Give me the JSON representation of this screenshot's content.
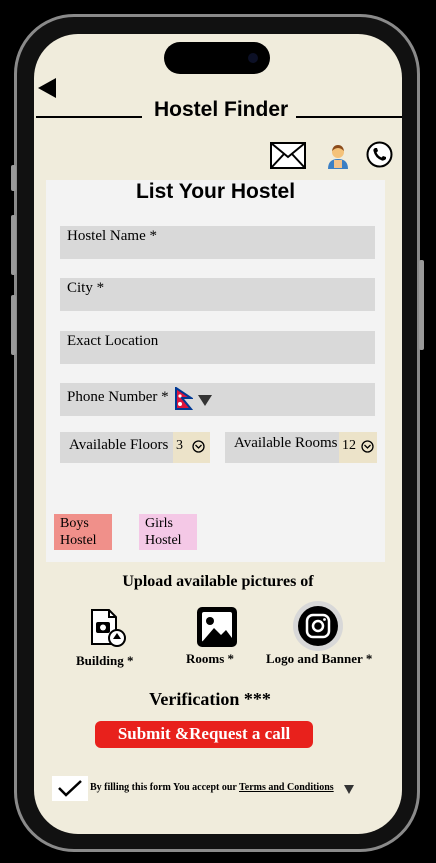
{
  "header": {
    "title": "Hostel Finder"
  },
  "icons": {
    "back": "back-arrow-icon",
    "mail": "mail-icon",
    "profile": "user-icon",
    "phone": "phone-icon"
  },
  "form": {
    "title": "List Your Hostel",
    "hostel_name_placeholder": "Hostel Name *",
    "city_placeholder": "City *",
    "location_placeholder": "Exact Location",
    "phone_placeholder": "Phone Number *",
    "floors_label": "Available Floors",
    "floors_value": "3",
    "rooms_label": "Available Rooms",
    "rooms_value": "12",
    "boys_label": "Boys Hostel",
    "girls_label": "Girls Hostel"
  },
  "upload": {
    "title": "Upload available pictures of",
    "items": [
      {
        "label": "Building *"
      },
      {
        "label": "Rooms *"
      },
      {
        "label": "Logo and Banner *"
      }
    ]
  },
  "verification": {
    "title": "Verification ***",
    "submit_label": "Submit &Request a call"
  },
  "terms": {
    "text": "By filling this form You accept our",
    "link": "Terms and Conditions"
  },
  "colors": {
    "background": "#f0ecdc",
    "submit": "#e8211c",
    "boys": "#f0908a",
    "girls": "#f4c8e6"
  }
}
